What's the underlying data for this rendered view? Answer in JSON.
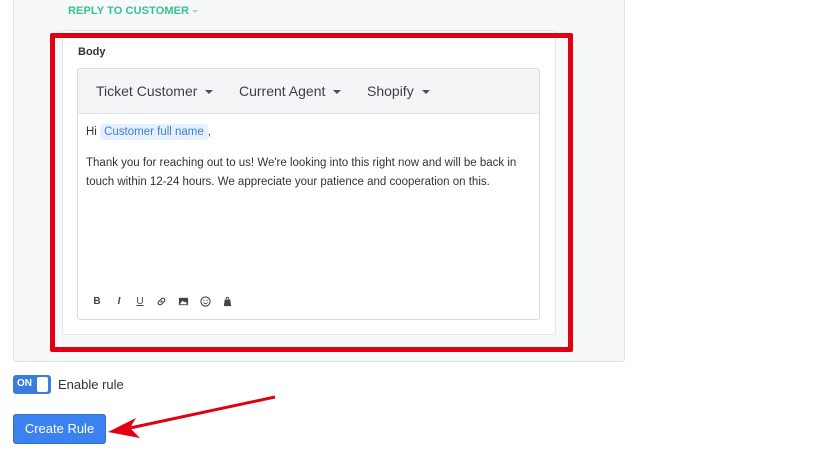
{
  "reply": {
    "label": "REPLY TO CUSTOMER"
  },
  "body_label": "Body",
  "toolbar": {
    "dropdowns": [
      "Ticket Customer",
      "Current Agent",
      "Shopify"
    ]
  },
  "content": {
    "greeting": "Hi",
    "variable": "Customer full name",
    "comma": ",",
    "paragraph_line1": "Thank you for reaching out to us! We're looking into this right now and will be back in",
    "paragraph_line2": "touch within 12-24 hours. We appreciate your patience and cooperation on this."
  },
  "format_icons": [
    "bold-icon",
    "italic-icon",
    "underline-icon",
    "link-icon",
    "image-icon",
    "emoji-icon",
    "shopify-icon"
  ],
  "format_labels": {
    "bold": "B",
    "italic": "I",
    "underline": "U"
  },
  "toggle": {
    "state": "ON",
    "label": "Enable rule"
  },
  "create_button": {
    "label": "Create Rule"
  },
  "colors": {
    "accent_green": "#34c38f",
    "primary_blue": "#3b82f0",
    "highlight_red": "#e0000f"
  }
}
